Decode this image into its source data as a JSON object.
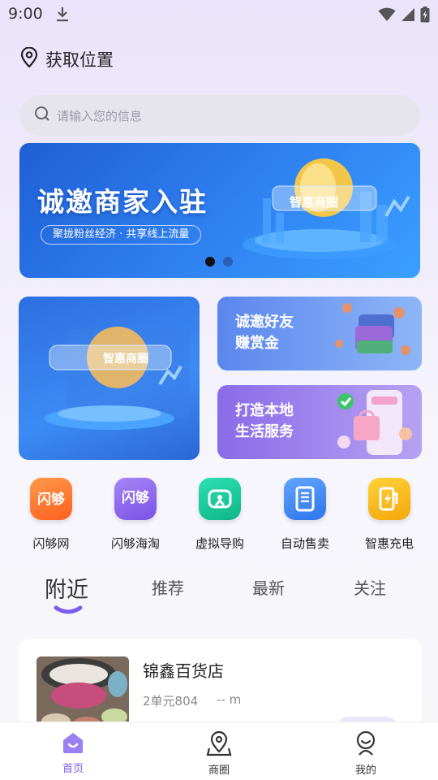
{
  "status_bar": {
    "time": "9:00"
  },
  "location": {
    "label": "获取位置"
  },
  "search": {
    "placeholder": "请输入您的信息"
  },
  "banner": {
    "title": "诚邀商家入驻",
    "subtitle": "聚拢粉丝经济 · 共享线上流量",
    "emblem_text": "智惠商圈",
    "active_dot": 0
  },
  "promo": {
    "left_emblem_text": "智惠商圈",
    "invite_line1": "诚邀好友",
    "invite_line2": "赚赏金",
    "service_line1": "打造本地",
    "service_line2": "生活服务"
  },
  "quick_entries": [
    {
      "label": "闪够网",
      "icon": "shangou-icon",
      "color": "#ff7a2d",
      "mark": "闪够"
    },
    {
      "label": "闪够海淘",
      "icon": "shangou-haitao-icon",
      "color": "#8b63ec",
      "mark": "闪够"
    },
    {
      "label": "虚拟导购",
      "icon": "virtual-guide-icon",
      "color": "#13c79a"
    },
    {
      "label": "自动售卖",
      "icon": "vending-icon",
      "color": "#3a86f2"
    },
    {
      "label": "智惠充电",
      "icon": "charging-icon",
      "color": "#f7b90f"
    }
  ],
  "tabs": [
    {
      "label": "附近",
      "active": true
    },
    {
      "label": "推荐",
      "active": false
    },
    {
      "label": "最新",
      "active": false
    },
    {
      "label": "关注",
      "active": false
    }
  ],
  "store": {
    "name": "锦鑫百货店",
    "address": "2单元804",
    "distance": "-- m"
  },
  "bottom_nav": [
    {
      "label": "首页",
      "icon": "home-icon",
      "active": true
    },
    {
      "label": "商圈",
      "icon": "map-pin-icon",
      "active": false
    },
    {
      "label": "我的",
      "icon": "profile-icon",
      "active": false
    }
  ],
  "colors": {
    "accent": "#7a5cf0",
    "banner_blue": "#2f7ff0"
  }
}
